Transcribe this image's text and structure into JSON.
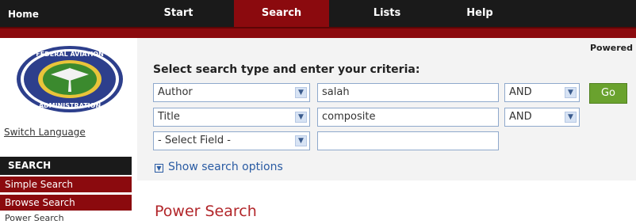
{
  "nav": {
    "home": "Home",
    "start": "Start",
    "search": "Search",
    "lists": "Lists",
    "help": "Help"
  },
  "sidebar": {
    "switch_language": "Switch Language",
    "header": "SEARCH",
    "items": [
      "Simple Search",
      "Browse Search",
      "Power Search"
    ]
  },
  "main": {
    "powered": "Powered",
    "heading": "Select search type and enter your criteria:",
    "rows": [
      {
        "field": "Author",
        "value": "salah",
        "operator": "AND"
      },
      {
        "field": "Title",
        "value": "composite",
        "operator": "AND"
      },
      {
        "field": "- Select Field -",
        "value": ""
      }
    ],
    "go_label": "Go",
    "show_options": "Show search options",
    "page_title": "Power Search"
  },
  "colors": {
    "nav_bg": "#1a1a1a",
    "accent_red": "#8b0a0e",
    "go_green": "#6aa22e",
    "link_blue": "#2a5ba3"
  }
}
